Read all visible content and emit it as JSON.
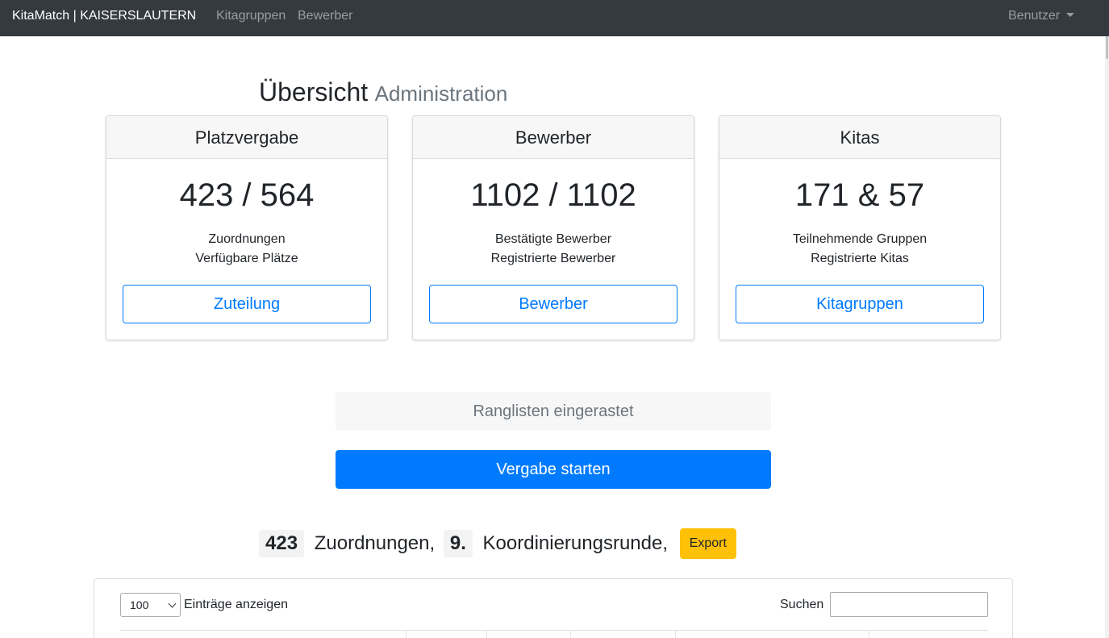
{
  "navbar": {
    "brand": "KitaMatch | KAISERSLAUTERN",
    "links": [
      "Kitagruppen",
      "Bewerber"
    ],
    "user_menu": "Benutzer"
  },
  "heading": {
    "title": "Übersicht",
    "subtitle": "Administration"
  },
  "cards": [
    {
      "header": "Platzvergabe",
      "value": "423 / 564",
      "line1": "Zuordnungen",
      "line2": "Verfügbare Plätze",
      "button": "Zuteilung"
    },
    {
      "header": "Bewerber",
      "value": "1102 / 1102",
      "line1": "Bestätigte Bewerber",
      "line2": "Registrierte Bewerber",
      "button": "Bewerber"
    },
    {
      "header": "Kitas",
      "value": "171 & 57",
      "line1": "Teilnehmende Gruppen",
      "line2": "Registrierte Kitas",
      "button": "Kitagruppen"
    }
  ],
  "status": {
    "text": "Ranglisten eingerastet",
    "start_button": "Vergabe starten"
  },
  "summary": {
    "count": "423",
    "count_label": "Zuordnungen,",
    "round": "9.",
    "round_label": "Koordinierungsrunde,",
    "export_button": "Export"
  },
  "table": {
    "page_length": "100",
    "length_label": "Einträge anzeigen",
    "search_label": "Suchen",
    "search_value": ""
  },
  "colors": {
    "navbar": "#343a40",
    "primary": "#007bff",
    "warning": "#ffc107",
    "muted": "#6c757d"
  }
}
